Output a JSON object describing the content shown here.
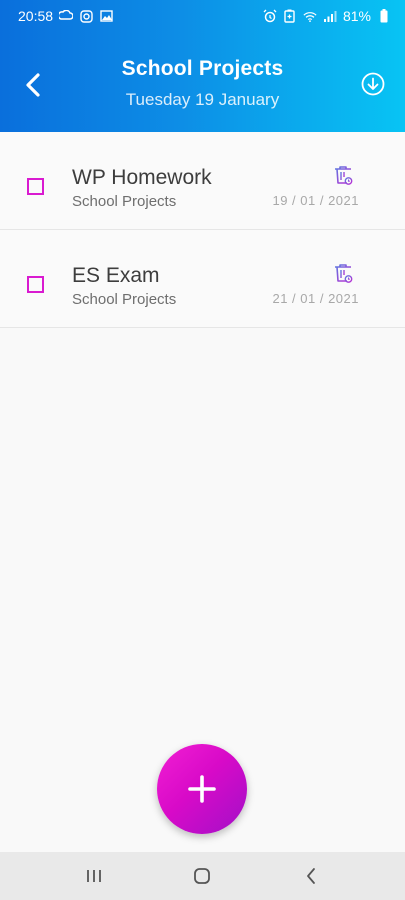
{
  "status": {
    "time": "20:58",
    "battery": "81%",
    "left_icons": [
      "cloud-sync-icon",
      "instagram-icon",
      "image-icon"
    ],
    "right_icons": [
      "alarm-icon",
      "battery-saver-icon",
      "wifi-icon",
      "signal-icon",
      "battery-icon"
    ]
  },
  "header": {
    "title": "School Projects",
    "subtitle": "Tuesday 19 January",
    "back_icon": "chevron-left-icon",
    "action_icon": "download-circle-icon"
  },
  "tasks": [
    {
      "title": "WP Homework",
      "list": "School Projects",
      "date": "19 / 01 / 2021",
      "checked": false
    },
    {
      "title": "ES Exam",
      "list": "School Projects",
      "date": "21 / 01 / 2021",
      "checked": false
    }
  ],
  "fab": {
    "icon": "plus-icon"
  },
  "navbar": {
    "items": [
      "recent-apps-icon",
      "home-icon",
      "back-icon"
    ]
  },
  "colors": {
    "header_start": "#0a6fdc",
    "header_end": "#08c4f4",
    "accent": "#d91ad0",
    "trash": "#8e5ad9"
  }
}
